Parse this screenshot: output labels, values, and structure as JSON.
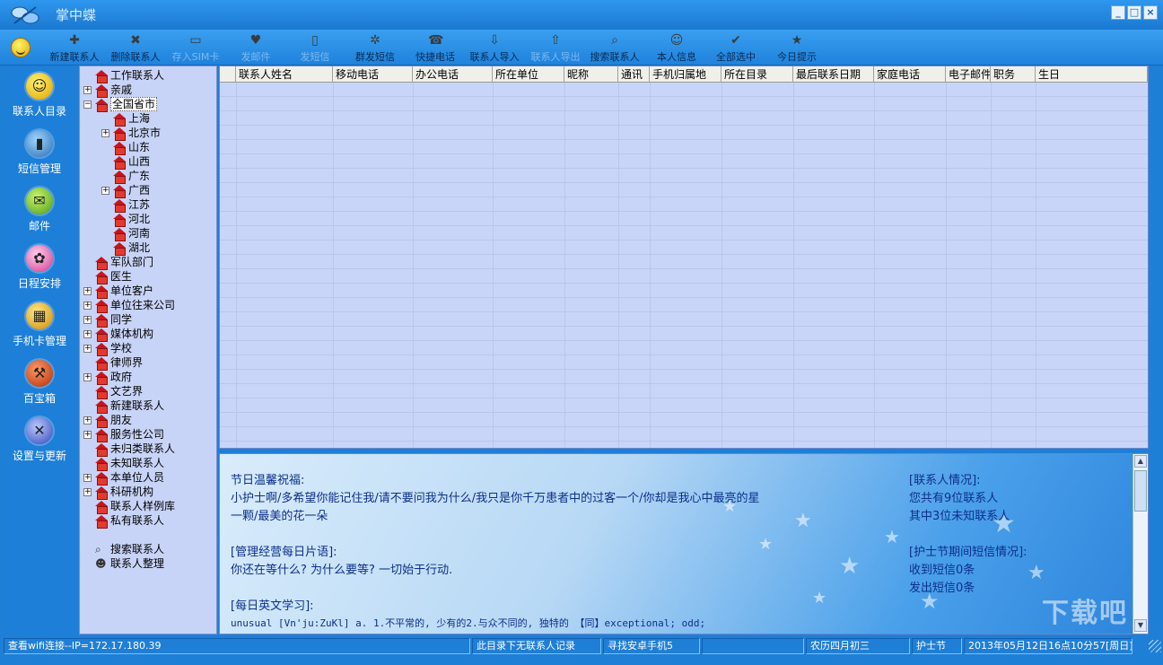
{
  "window": {
    "title": "掌中蝶"
  },
  "toolbar": {
    "buttons": [
      {
        "label": "新建联系人",
        "icon": "person-add-icon"
      },
      {
        "label": "删除联系人",
        "icon": "person-delete-icon"
      },
      {
        "label": "存入SIM卡",
        "icon": "sim-card-icon"
      },
      {
        "label": "发邮件",
        "icon": "mail-icon"
      },
      {
        "label": "发短信",
        "icon": "sms-icon"
      },
      {
        "label": "群发短信",
        "icon": "broadcast-icon"
      },
      {
        "label": "快捷电话",
        "icon": "phone-icon"
      },
      {
        "label": "联系人导入",
        "icon": "import-icon"
      },
      {
        "label": "联系人导出",
        "icon": "export-icon"
      },
      {
        "label": "搜索联系人",
        "icon": "search-icon"
      },
      {
        "label": "本人信息",
        "icon": "user-info-icon"
      },
      {
        "label": "全部选中",
        "icon": "select-all-icon"
      },
      {
        "label": "今日提示",
        "icon": "tip-icon"
      }
    ]
  },
  "nav": {
    "items": [
      {
        "label": "联系人目录",
        "icon": "smiley-icon"
      },
      {
        "label": "短信管理",
        "icon": "mobile-phone-icon"
      },
      {
        "label": "邮件",
        "icon": "envelope-icon"
      },
      {
        "label": "日程安排",
        "icon": "calendar-icon"
      },
      {
        "label": "手机卡管理",
        "icon": "sim-card-icon"
      },
      {
        "label": "百宝箱",
        "icon": "toolbox-icon"
      },
      {
        "label": "设置与更新",
        "icon": "settings-icon"
      }
    ]
  },
  "tree": {
    "items": [
      {
        "label": "工作联系人"
      },
      {
        "label": "亲戚"
      },
      {
        "label": "全国省市"
      },
      {
        "label": "上海"
      },
      {
        "label": "北京市"
      },
      {
        "label": "山东"
      },
      {
        "label": "山西"
      },
      {
        "label": "广东"
      },
      {
        "label": "广西"
      },
      {
        "label": "江苏"
      },
      {
        "label": "河北"
      },
      {
        "label": "河南"
      },
      {
        "label": "湖北"
      },
      {
        "label": "军队部门"
      },
      {
        "label": "医生"
      },
      {
        "label": "单位客户"
      },
      {
        "label": "单位往来公司"
      },
      {
        "label": "同学"
      },
      {
        "label": "媒体机构"
      },
      {
        "label": "学校"
      },
      {
        "label": "律师界"
      },
      {
        "label": "政府"
      },
      {
        "label": "文艺界"
      },
      {
        "label": "新建联系人"
      },
      {
        "label": "朋友"
      },
      {
        "label": "服务性公司"
      },
      {
        "label": "未归类联系人"
      },
      {
        "label": "未知联系人"
      },
      {
        "label": "本单位人员"
      },
      {
        "label": "科研机构"
      },
      {
        "label": "联系人样例库"
      },
      {
        "label": "私有联系人"
      }
    ],
    "tools": [
      {
        "label": "搜索联系人"
      },
      {
        "label": "联系人整理"
      }
    ]
  },
  "grid": {
    "columns": [
      "联系人姓名",
      "移动电话",
      "办公电话",
      "所在单位",
      "昵称",
      "通讯",
      "手机归属地",
      "所在目录",
      "最后联系日期",
      "家庭电话",
      "电子邮件",
      "职务",
      "生日"
    ]
  },
  "info": {
    "greeting_title": "节日温馨祝福:",
    "greeting_line1": "小护士啊/多希望你能记住我/请不要问我为什么/我只是你千万患者中的过客一个/你却是我心中最亮的星",
    "greeting_line2": "一颗/最美的花一朵",
    "quote_title": "[管理经营每日片语]:",
    "quote_text": "你还在等什么? 为什么要等? 一切始于行动.",
    "english_title": "[每日英文学习]:",
    "english_text": "unusual [Vn'ju:ZuKl] a. 1.不平常的, 少有的2.与众不同的, 独特的 【同】exceptional; odd;",
    "contacts_title": "[联系人情况]:",
    "contacts_total": "您共有9位联系人",
    "contacts_unknown": "其中3位未知联系人",
    "sms_title": "[护士节期间短信情况]:",
    "sms_received": "收到短信0条",
    "sms_sent": "发出短信0条",
    "watermark": "下载吧"
  },
  "status": {
    "wifi": "查看wifi连接--IP=172.17.180.39",
    "records": "此目录下无联系人记录",
    "phone": "寻找安卓手机5",
    "empty": "",
    "lunar": "农历四月初三",
    "festival": "护士节",
    "datetime": "2013年05月12日16点10分57[周日]"
  }
}
